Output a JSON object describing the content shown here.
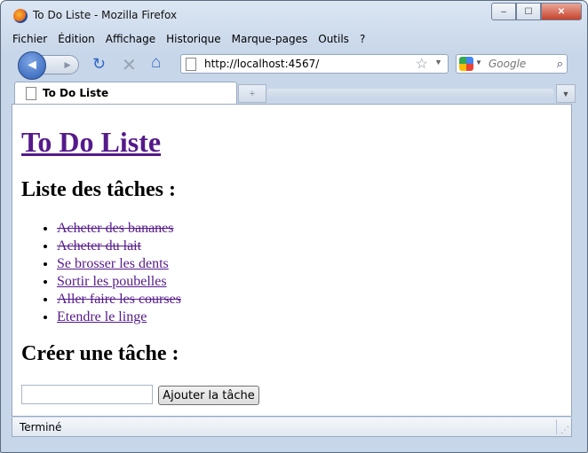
{
  "window": {
    "title": "To Do Liste - Mozilla Firefox",
    "controls": {
      "minimize": "–",
      "maximize": "☐",
      "close": "✕"
    }
  },
  "menu": [
    "Fichier",
    "Édition",
    "Affichage",
    "Historique",
    "Marque-pages",
    "Outils",
    "?"
  ],
  "nav": {
    "url": "http://localhost:4567/",
    "search_placeholder": "Google",
    "icons": [
      "back-icon",
      "forward-icon",
      "reload-icon",
      "stop-icon",
      "home-icon",
      "bookmark-star-icon",
      "google-icon",
      "search-icon"
    ]
  },
  "tabs": [
    {
      "label": "To Do Liste",
      "active": true
    }
  ],
  "page": {
    "title": "To Do Liste",
    "tasks_heading": "Liste des tâches :",
    "tasks": [
      {
        "label": "Acheter des bananes",
        "done": true
      },
      {
        "label": "Acheter du lait",
        "done": true
      },
      {
        "label": "Se brosser les dents",
        "done": false
      },
      {
        "label": "Sortir les poubelles",
        "done": false
      },
      {
        "label": "Aller faire les courses",
        "done": true
      },
      {
        "label": "Etendre le linge",
        "done": false
      }
    ],
    "create_heading": "Créer une tâche :",
    "task_input_value": "",
    "add_button": "Ajouter la tâche"
  },
  "status": {
    "text": "Terminé"
  },
  "colors": {
    "link_visited": "#551a8b",
    "chrome": "#c7d6e9"
  }
}
